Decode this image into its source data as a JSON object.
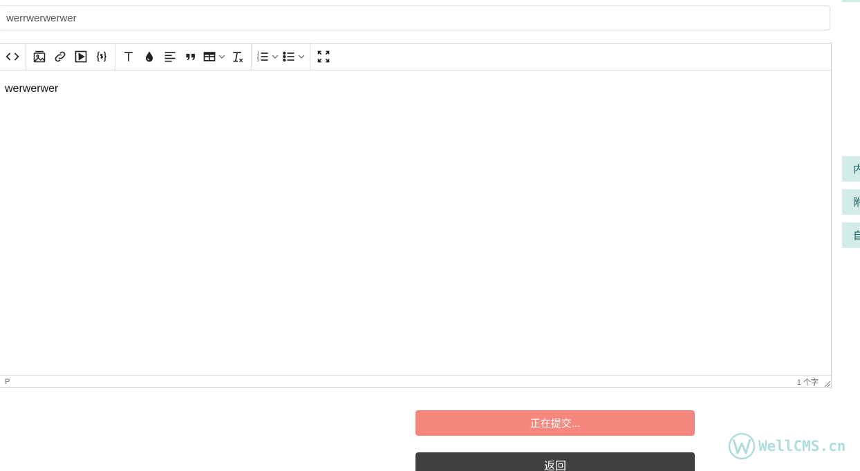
{
  "title_field": {
    "value": "werrwerwerwer"
  },
  "toolbar": {
    "groups": [
      [
        "code-view-icon"
      ],
      [
        "image-icon",
        "link-icon",
        "video-icon",
        "code-block-icon"
      ],
      [
        "font-size-icon",
        "font-color-icon",
        "align-icon",
        "quote-icon",
        "table-icon",
        "clear-format-icon"
      ],
      [
        "ordered-list-icon",
        "bullet-list-icon"
      ],
      [
        "fullscreen-icon"
      ]
    ]
  },
  "editor": {
    "content": "werwerwer",
    "status_tag": "P",
    "word_count": "1 个字"
  },
  "buttons": {
    "submit_label": "正在提交...",
    "back_label": "返回"
  },
  "side_tabs": [
    "内",
    "附",
    "自"
  ],
  "watermark": {
    "text": "WellCMS.cn"
  },
  "colors": {
    "submit": "#f5877f",
    "back": "#414141",
    "side_tab_bg": "#d3ecea",
    "watermark": "#6ec3c6"
  }
}
